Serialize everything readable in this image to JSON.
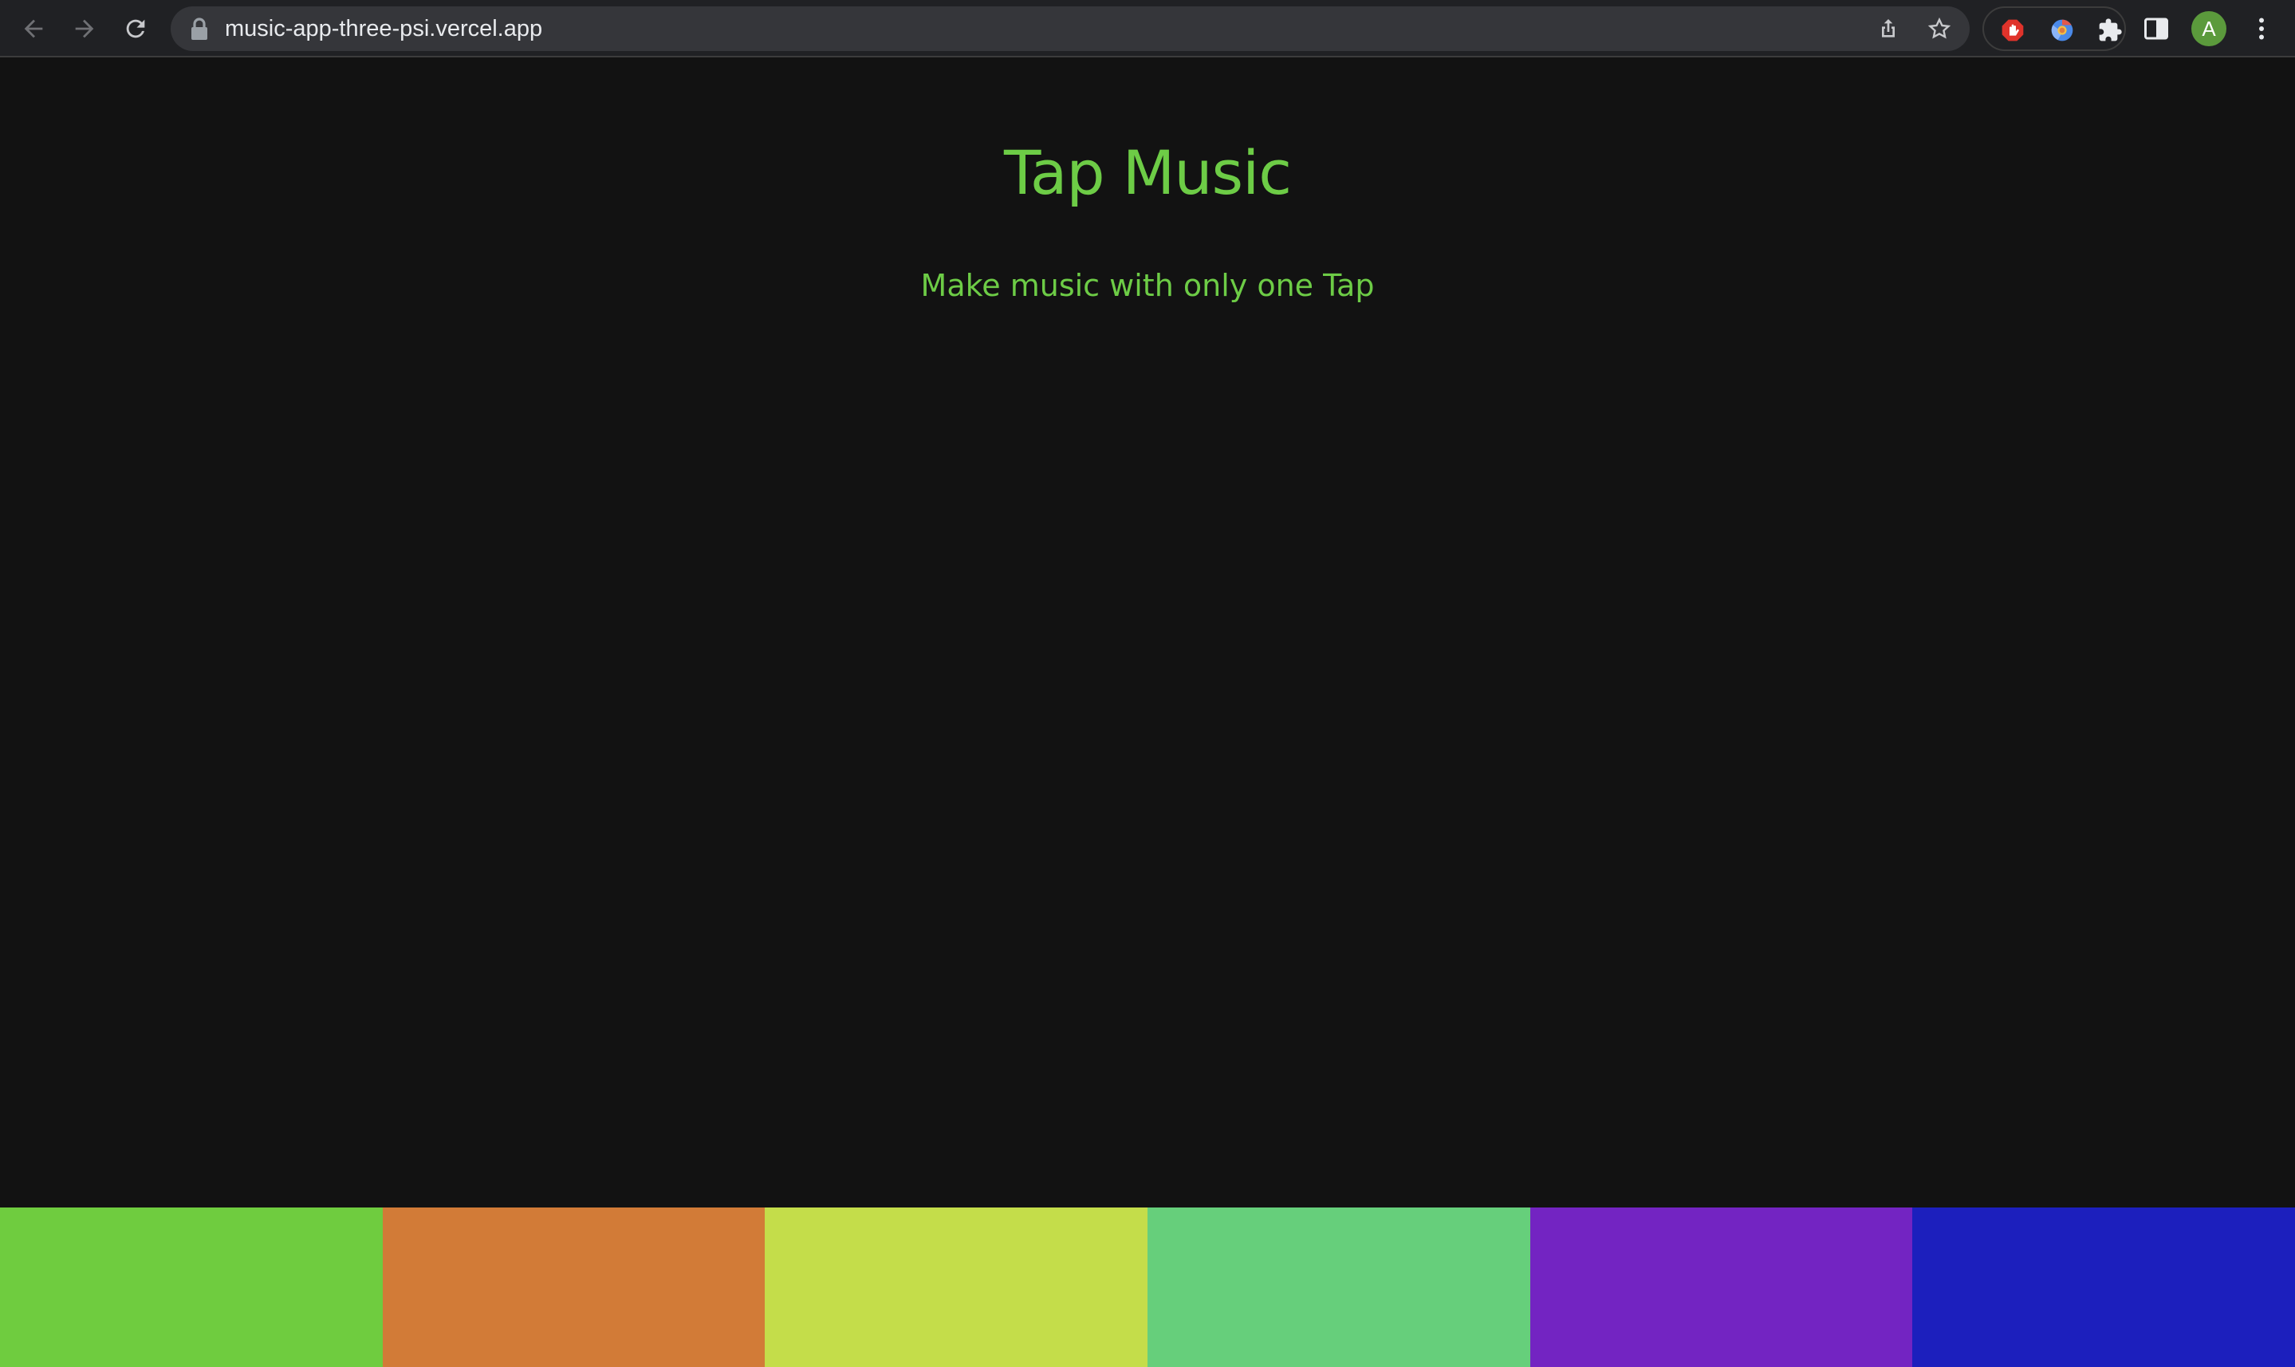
{
  "browser": {
    "url": "music-app-three-psi.vercel.app",
    "avatar_letter": "A",
    "icons": [
      "back-arrow-icon",
      "forward-arrow-icon",
      "reload-icon",
      "lock-icon",
      "share-icon",
      "bookmark-star-icon",
      "adblock-extension-icon",
      "chrome-extension-icon",
      "puzzle-extensions-icon",
      "side-panel-icon",
      "kebab-menu-icon"
    ]
  },
  "app": {
    "title": "Tap Music",
    "subtitle": "Make music with only one Tap"
  },
  "pads": [
    {
      "name": "pad-1",
      "color": "#6fcc3f"
    },
    {
      "name": "pad-2",
      "color": "#d27b37"
    },
    {
      "name": "pad-3",
      "color": "#c4dd4a"
    },
    {
      "name": "pad-4",
      "color": "#66cf7b"
    },
    {
      "name": "pad-5",
      "color": "#7324c2"
    },
    {
      "name": "pad-6",
      "color": "#1c1fbd"
    }
  ],
  "colors": {
    "accent": "#6dcc46",
    "background": "#121212"
  }
}
